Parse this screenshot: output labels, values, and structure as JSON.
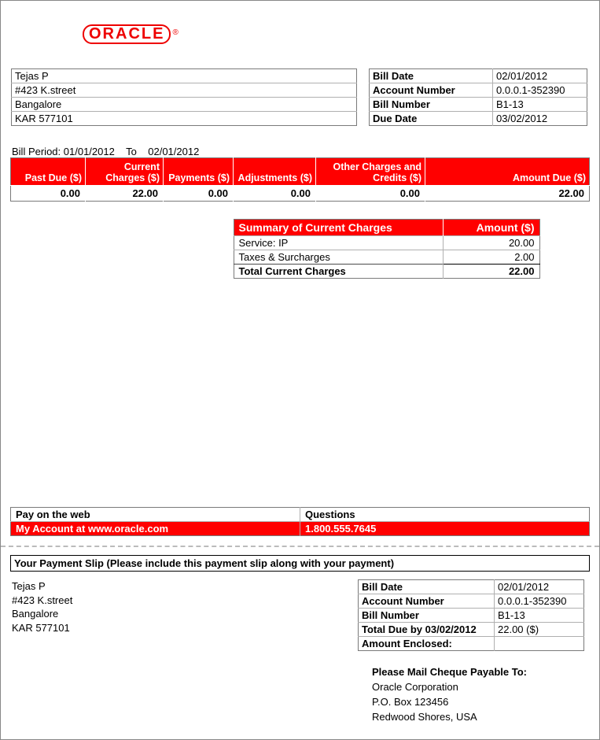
{
  "logo": {
    "text": "ORACLE",
    "reg": "®"
  },
  "customer": {
    "name": "Tejas P",
    "street": "#423 K.street",
    "city": "Bangalore",
    "region": "KAR 577101"
  },
  "bill_meta": {
    "bill_date_label": "Bill Date",
    "bill_date": "02/01/2012",
    "account_number_label": "Account Number",
    "account_number": "0.0.0.1-352390",
    "bill_number_label": "Bill Number",
    "bill_number": "B1-13",
    "due_date_label": "Due Date",
    "due_date": "03/02/2012"
  },
  "period": {
    "label_prefix": "Bill Period:",
    "from": "01/01/2012",
    "to_label": "To",
    "to": "02/01/2012"
  },
  "charges_headers": {
    "past_due": "Past Due ($)",
    "current": "Current Charges ($)",
    "payments": "Payments ($)",
    "adjustments": "Adjustments ($)",
    "other": "Other Charges and Credits ($)",
    "amount_due": "Amount Due ($)"
  },
  "charges_values": {
    "past_due": "0.00",
    "current": "22.00",
    "payments": "0.00",
    "adjustments": "0.00",
    "other": "0.00",
    "amount_due": "22.00"
  },
  "summary": {
    "title": "Summary of Current Charges",
    "amount_header": "Amount ($)",
    "rows": [
      {
        "label": "Service: IP",
        "amount": "20.00"
      },
      {
        "label": "Taxes & Surcharges",
        "amount": "2.00"
      }
    ],
    "total_label": "Total Current Charges",
    "total_amount": "22.00"
  },
  "contact": {
    "web_label": "Pay on the web",
    "questions_label": "Questions",
    "web_value": "My Account at www.oracle.com",
    "phone": "1.800.555.7645"
  },
  "slip": {
    "title": "Your Payment Slip (Please include this payment slip along with your payment)",
    "meta": {
      "bill_date_label": "Bill Date",
      "bill_date": "02/01/2012",
      "account_number_label": "Account Number",
      "account_number": "0.0.0.1-352390",
      "bill_number_label": "Bill Number",
      "bill_number": "B1-13",
      "total_due_label": "Total Due by 03/02/2012",
      "total_due": "22.00 ($)",
      "enclosed_label": "Amount Enclosed:",
      "enclosed": ""
    }
  },
  "mailto": {
    "header": "Please Mail Cheque Payable To:",
    "line1": "Oracle Corporation",
    "line2": "P.O. Box 123456",
    "line3": "Redwood Shores, USA"
  }
}
